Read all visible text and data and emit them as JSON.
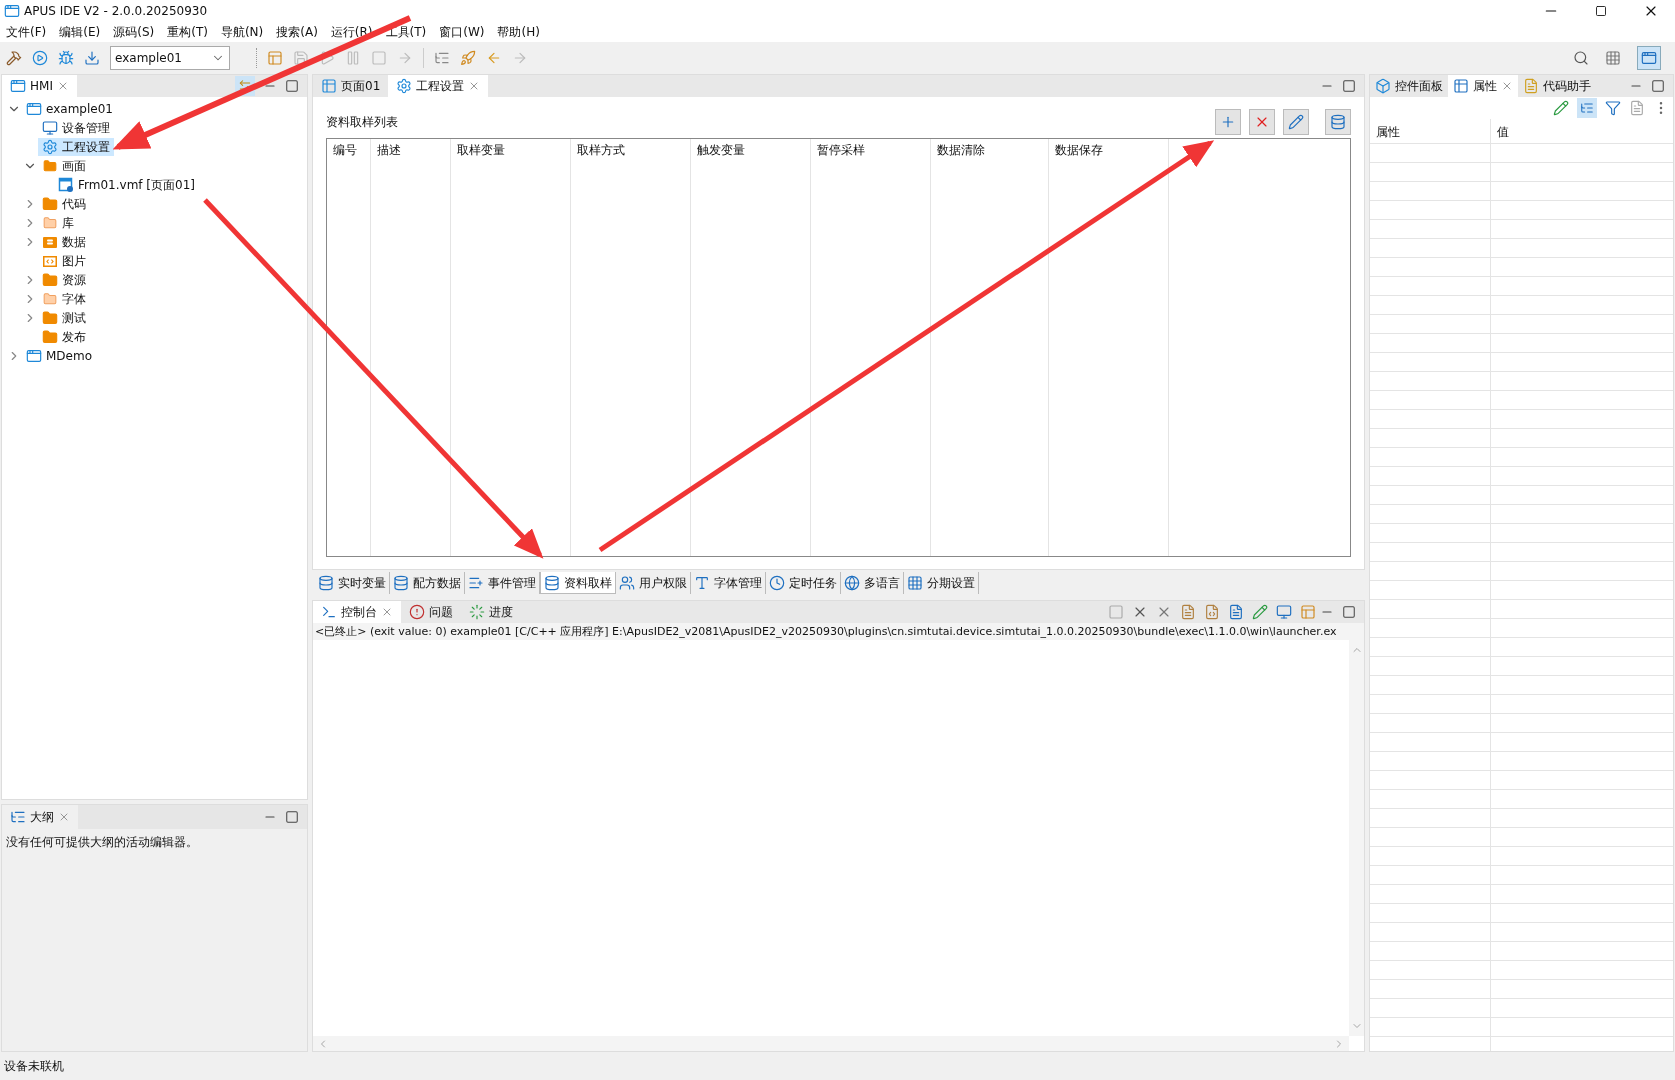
{
  "window": {
    "title": "APUS IDE V2 - 2.0.0.20250930"
  },
  "menu": [
    "文件(F)",
    "编辑(E)",
    "源码(S)",
    "重构(T)",
    "导航(N)",
    "搜索(A)",
    "运行(R)",
    "工具(T)",
    "窗口(W)",
    "帮助(H)"
  ],
  "toolbar": {
    "project_combo": "example01"
  },
  "explorer": {
    "tab": "HMI",
    "tree": [
      {
        "label": "example01",
        "kind": "project",
        "expanded": true,
        "selected": false,
        "children": [
          {
            "label": "设备管理",
            "kind": "device",
            "selected": false
          },
          {
            "label": "工程设置",
            "kind": "settings",
            "selected": true
          },
          {
            "label": "画面",
            "kind": "screen-folder",
            "expanded": true,
            "selected": false,
            "children": [
              {
                "label": "Frm01.vmf [页面01]",
                "kind": "page-file",
                "selected": false
              }
            ]
          },
          {
            "label": "代码",
            "kind": "folder",
            "expanded": false,
            "selected": false
          },
          {
            "label": "库",
            "kind": "lib-folder",
            "expanded": false,
            "selected": false
          },
          {
            "label": "数据",
            "kind": "data-folder",
            "expanded": false,
            "selected": false
          },
          {
            "label": "图片",
            "kind": "image-folder",
            "selected": false
          },
          {
            "label": "资源",
            "kind": "folder",
            "expanded": false,
            "selected": false
          },
          {
            "label": "字体",
            "kind": "font-folder",
            "expanded": false,
            "selected": false
          },
          {
            "label": "测试",
            "kind": "folder",
            "expanded": false,
            "selected": false
          },
          {
            "label": "发布",
            "kind": "folder",
            "selected": false
          }
        ]
      },
      {
        "label": "MDemo",
        "kind": "project",
        "expanded": false,
        "selected": false
      }
    ]
  },
  "outline": {
    "tab": "大纲",
    "message": "没有任何可提供大纲的活动编辑器。"
  },
  "editor": {
    "tabs": [
      {
        "label": "页面01",
        "kind": "page",
        "selected": false
      },
      {
        "label": "工程设置",
        "kind": "settings",
        "selected": true
      }
    ],
    "section_title": "资料取样列表",
    "table": {
      "columns": [
        "编号",
        "描述",
        "取样变量",
        "取样方式",
        "触发变量",
        "暂停采样",
        "数据清除",
        "数据保存"
      ]
    },
    "bottom_tabs": [
      {
        "label": "实时变量",
        "selected": false
      },
      {
        "label": "配方数据",
        "selected": false
      },
      {
        "label": "事件管理",
        "selected": false
      },
      {
        "label": "资料取样",
        "selected": true
      },
      {
        "label": "用户权限",
        "selected": false
      },
      {
        "label": "字体管理",
        "selected": false
      },
      {
        "label": "定时任务",
        "selected": false
      },
      {
        "label": "多语言",
        "selected": false
      },
      {
        "label": "分期设置",
        "selected": false
      }
    ]
  },
  "console": {
    "tabs": [
      {
        "label": "控制台",
        "selected": true
      },
      {
        "label": "问题",
        "selected": false
      },
      {
        "label": "进度",
        "selected": false
      }
    ],
    "line": "<已终止> (exit value: 0) example01 [C/C++ 应用程序] E:\\ApusIDE2_v2081\\ApusIDE2_v20250930\\plugins\\cn.simtutai.device.simtutai_1.0.0.20250930\\bundle\\exec\\1.1.0.0\\win\\launcher.ex"
  },
  "properties": {
    "tabs": [
      {
        "label": "控件面板",
        "selected": false
      },
      {
        "label": "属性",
        "selected": true
      },
      {
        "label": "代码助手",
        "selected": false
      }
    ],
    "columns": [
      "属性",
      "值"
    ]
  },
  "status_bar": "设备未联机"
}
